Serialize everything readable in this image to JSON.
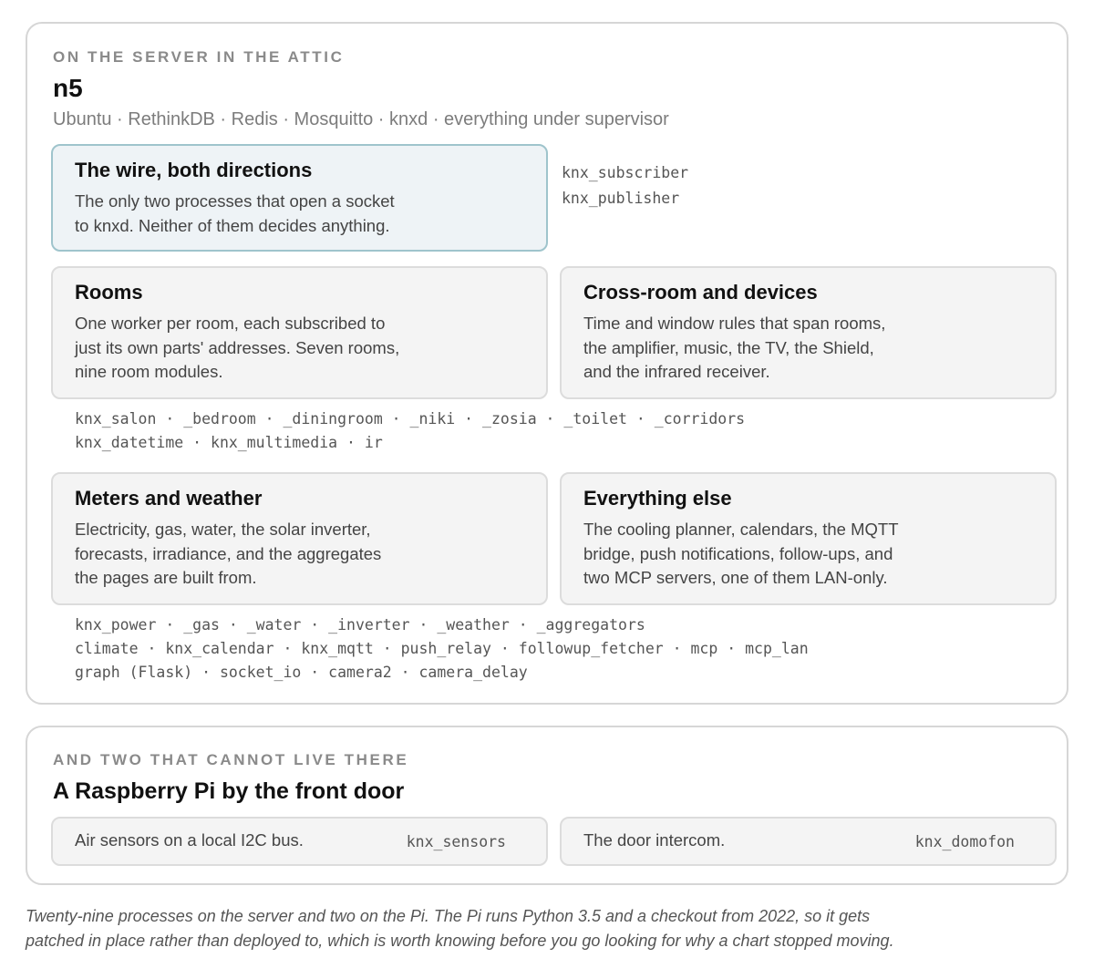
{
  "server": {
    "eyebrow": "ON THE SERVER IN THE ATTIC",
    "host": "n5",
    "stack": "Ubuntu · RethinkDB · Redis · Mosquitto · knxd · everything under supervisor",
    "wire": {
      "title": "The wire, both directions",
      "lines": [
        "The only two processes that open a socket",
        "to knxd. Neither of them decides anything."
      ],
      "procs": [
        "knx_subscriber",
        "knx_publisher"
      ]
    },
    "rooms": {
      "title": "Rooms",
      "lines": [
        "One worker per room, each subscribed to",
        "just its own parts' addresses. Seven rooms,",
        "nine room modules."
      ]
    },
    "crossroom": {
      "title": "Cross-room and devices",
      "lines": [
        "Time and window rules that span rooms,",
        "the amplifier, music, the TV, the Shield,",
        "and the infrared receiver."
      ]
    },
    "rooms_procs": [
      "knx_salon · _bedroom · _diningroom · _niki · _zosia · _toilet · _corridors",
      "knx_datetime · knx_multimedia · ir"
    ],
    "meters": {
      "title": "Meters and weather",
      "lines": [
        "Electricity, gas, water, the solar inverter,",
        "forecasts, irradiance, and the aggregates",
        "the pages are built from."
      ]
    },
    "else": {
      "title": "Everything else",
      "lines": [
        "The cooling planner, calendars, the MQTT",
        "bridge, push notifications, follow-ups, and",
        "two MCP servers, one of them LAN-only."
      ]
    },
    "meters_procs": [
      "knx_power · _gas · _water · _inverter · _weather · _aggregators",
      "climate · knx_calendar · knx_mqtt · push_relay · followup_fetcher · mcp · mcp_lan",
      "graph (Flask) · socket_io · camera2 · camera_delay"
    ]
  },
  "pi": {
    "eyebrow": "AND TWO THAT CANNOT LIVE THERE",
    "host": "A Raspberry Pi by the front door",
    "items": [
      {
        "desc": "Air sensors on a local I2C bus.",
        "proc": "knx_sensors"
      },
      {
        "desc": "The door intercom.",
        "proc": "knx_domofon"
      }
    ]
  },
  "caption": {
    "line1": "Twenty-nine processes on the server and two on the Pi. The Pi runs Python 3.5 and a checkout from 2022, so it gets",
    "line2": "patched in place rather than deployed to, which is worth knowing before you go looking for why a chart stopped moving."
  }
}
